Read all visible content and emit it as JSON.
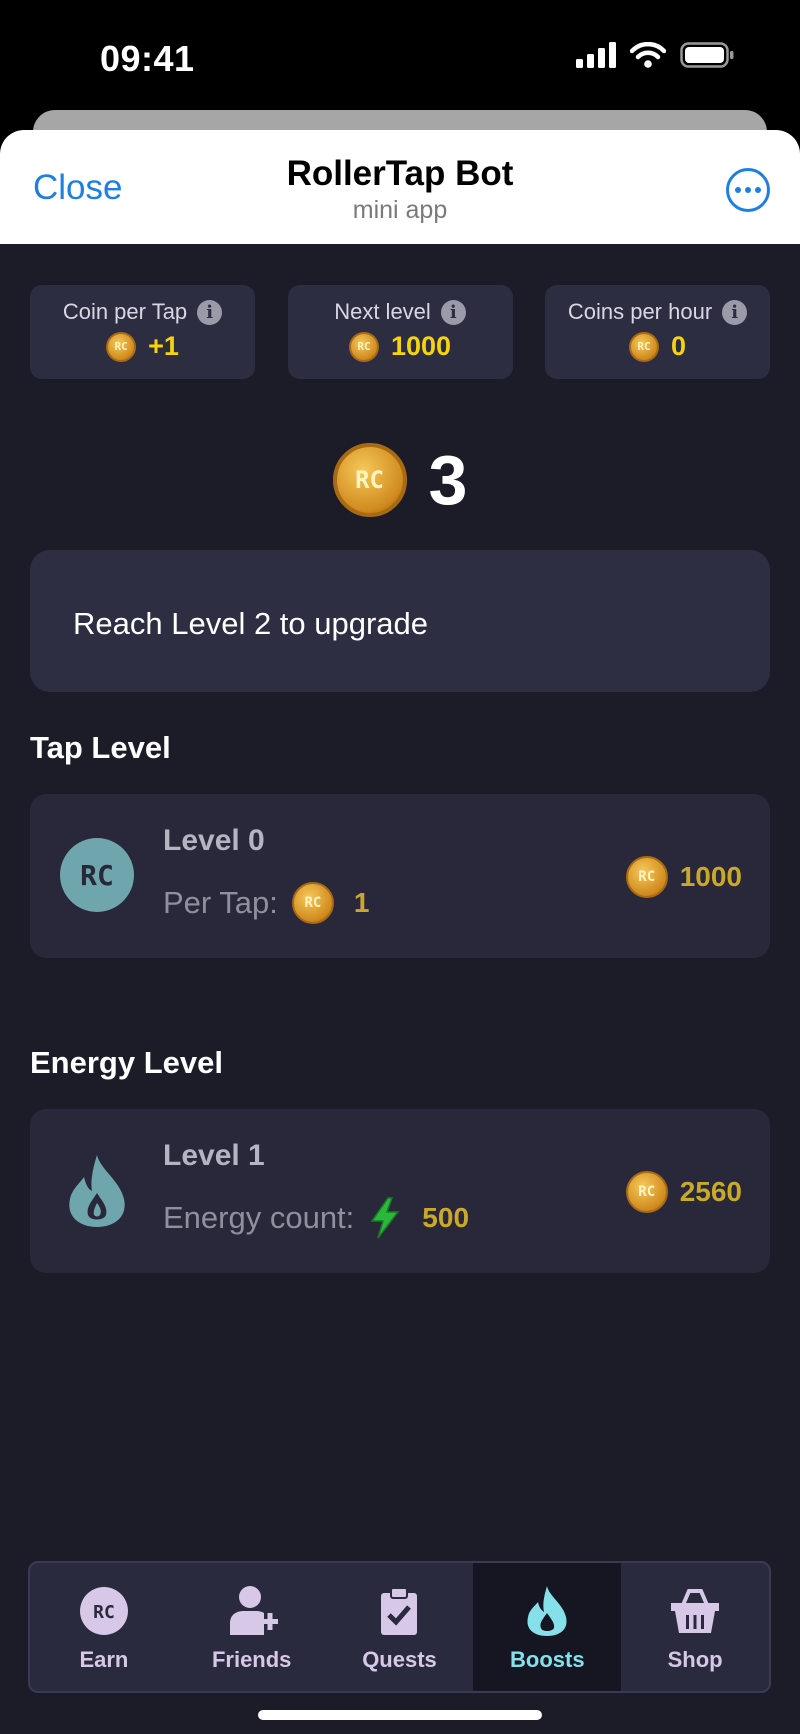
{
  "status_bar": {
    "time": "09:41"
  },
  "header": {
    "close_label": "Close",
    "title": "RollerTap Bot",
    "subtitle": "mini app",
    "more_icon": "ellipsis-circle-icon"
  },
  "stats": [
    {
      "label": "Coin per Tap",
      "value": "+1",
      "info_glyph": "i"
    },
    {
      "label": "Next level",
      "value": "1000",
      "info_glyph": "i"
    },
    {
      "label": "Coins per hour",
      "value": "0",
      "info_glyph": "i"
    }
  ],
  "coin_mark": "RC",
  "balance": "3",
  "notice": "Reach Level 2 to upgrade",
  "tap_level": {
    "section_title": "Tap Level",
    "icon_text": "RC",
    "level": "Level 0",
    "detail_label": "Per Tap:",
    "detail_value": "1",
    "price": "1000"
  },
  "energy_level": {
    "section_title": "Energy Level",
    "level": "Level 1",
    "detail_label": "Energy count:",
    "detail_value": "500",
    "price": "2560"
  },
  "nav": {
    "items": [
      {
        "label": "Earn",
        "icon": "rc-coin-icon",
        "icon_text": "RC"
      },
      {
        "label": "Friends",
        "icon": "add-friend-icon"
      },
      {
        "label": "Quests",
        "icon": "clipboard-check-icon"
      },
      {
        "label": "Boosts",
        "icon": "flame-icon"
      },
      {
        "label": "Shop",
        "icon": "basket-icon"
      }
    ],
    "active_index": 3
  },
  "colors": {
    "accent_blue": "#1e7fe0",
    "background": "#1c1c28",
    "card": "#2d2d42",
    "gold": "#f6d40d",
    "teal_icon": "#6fa6ad",
    "active_nav": "#86e0ea"
  }
}
